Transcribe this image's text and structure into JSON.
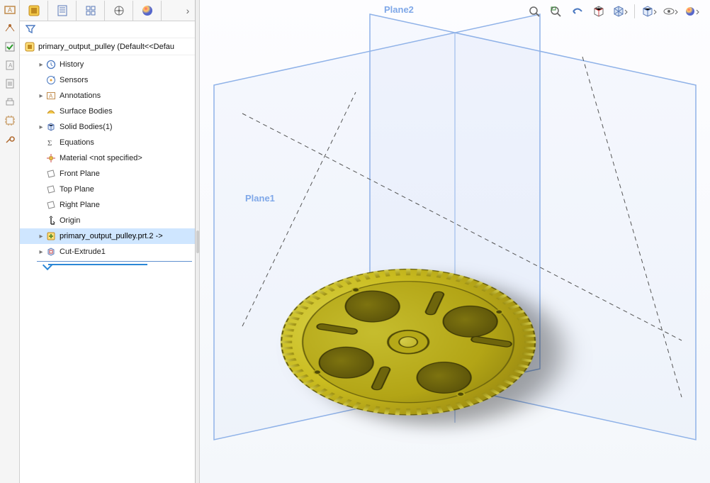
{
  "root": {
    "label": "primary_output_pulley  (Default<<Defau"
  },
  "tree": {
    "items": [
      {
        "label": "History",
        "icon": "history",
        "children": true,
        "indent": 1
      },
      {
        "label": "Sensors",
        "icon": "sensors",
        "children": false,
        "indent": 1
      },
      {
        "label": "Annotations",
        "icon": "annotations",
        "children": true,
        "indent": 1
      },
      {
        "label": "Surface Bodies",
        "icon": "surface-bodies",
        "children": false,
        "indent": 1
      },
      {
        "label": "Solid Bodies(1)",
        "icon": "solid-bodies",
        "children": true,
        "indent": 1
      },
      {
        "label": "Equations",
        "icon": "equations",
        "children": false,
        "indent": 1
      },
      {
        "label": "Material <not specified>",
        "icon": "material",
        "children": false,
        "indent": 1
      },
      {
        "label": "Front Plane",
        "icon": "plane",
        "children": false,
        "indent": 1
      },
      {
        "label": "Top Plane",
        "icon": "plane",
        "children": false,
        "indent": 1
      },
      {
        "label": "Right Plane",
        "icon": "plane",
        "children": false,
        "indent": 1
      },
      {
        "label": "Origin",
        "icon": "origin",
        "children": false,
        "indent": 1
      },
      {
        "label": "primary_output_pulley.prt.2 ->",
        "icon": "imported",
        "children": true,
        "indent": 1,
        "selected": true
      },
      {
        "label": "Cut-Extrude1",
        "icon": "cut-extrude",
        "children": true,
        "indent": 1
      }
    ]
  },
  "viewport": {
    "plane1": "Plane1",
    "plane2": "Plane2"
  }
}
